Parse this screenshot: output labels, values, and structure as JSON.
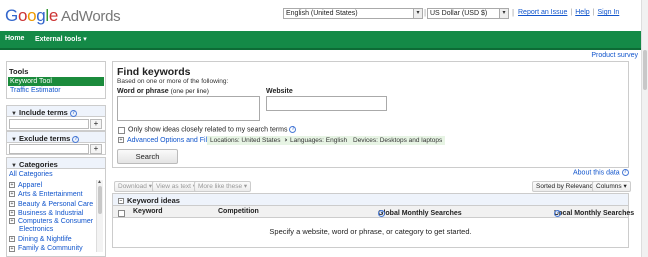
{
  "brand": {
    "logo_letters": [
      "G",
      "o",
      "o",
      "g",
      "l",
      "e"
    ],
    "product": "AdWords"
  },
  "header": {
    "language_select": "English (United States)",
    "currency_select": "US Dollar (USD $)",
    "links": [
      "Report an Issue",
      "Help",
      "Sign In"
    ],
    "separator": "|"
  },
  "nav": {
    "home": "Home",
    "external_tools": "External tools",
    "external_tools_arrow": "▾"
  },
  "survey": "Product survey",
  "sidebar": {
    "tools_title": "Tools",
    "tools": [
      "Keyword Tool",
      "Traffic Estimator"
    ],
    "include_terms": "Include terms",
    "exclude_terms": "Exclude terms",
    "plus": "+",
    "categories_title": "Categories",
    "all_categories": "All Categories",
    "categories": [
      "Apparel",
      "Arts & Entertainment",
      "Beauty & Personal Care",
      "Business & Industrial",
      "Computers & Consumer Electronics",
      "Dining & Nightlife",
      "Family & Community"
    ]
  },
  "find": {
    "title": "Find keywords",
    "subtitle": "Based on one or more of the following:",
    "phrase_label": "Word or phrase",
    "phrase_hint": "(one per line)",
    "website_label": "Website",
    "only_related": "Only show ideas closely related to my search terms",
    "advanced_link": "Advanced Options and Filters",
    "chips": [
      "Locations: United States",
      "Languages: English",
      "Devices: Desktops and laptops"
    ],
    "chip_close": "×",
    "search_button": "Search"
  },
  "about": "About this data",
  "toolbar": {
    "download": "Download ▾",
    "view_as_text": "View as text ▾",
    "more_like_these": "More like these ▾",
    "sorted_by": "Sorted by Relevance ▾",
    "columns": "Columns ▾"
  },
  "results": {
    "title": "Keyword ideas",
    "columns": [
      "Keyword",
      "Competition",
      "Global Monthly Searches",
      "Local Monthly Searches"
    ],
    "empty_message": "Specify a website, word or phrase, or category to get started."
  },
  "colors": {
    "nav_green": "#148a47",
    "selected_green": "#1b8b3c",
    "link_blue": "#1155cc",
    "header_blue_bg": "#eef3fb"
  }
}
